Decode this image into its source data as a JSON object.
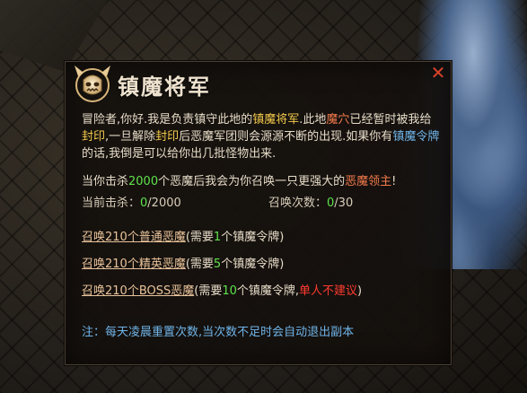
{
  "dialog": {
    "title": "镇魔将军",
    "intro": {
      "p1": "冒险者,你好.我是负责镇守此地的",
      "name": "镇魔将军",
      "p2": ".此地",
      "cave": "魔穴",
      "p3": "已经暂时被我给",
      "seal1": "封印",
      "p4": ",一旦解除",
      "seal2": "封印",
      "p5": "后恶魔军团则会源源不断的出现.如果你有",
      "token": "镇魔令牌",
      "p6": "的话,我倒是可以给你出几批怪物出来."
    },
    "summon_info": {
      "p1": "当你击杀",
      "count": "2000",
      "p2": "个恶魔后我会为你召唤一只更强大的",
      "lord": "恶魔领主",
      "p3": "!"
    },
    "kills": {
      "label": "当前击杀：",
      "current": "0",
      "total": "/2000"
    },
    "summons": {
      "label": "召唤次数：",
      "current": "0",
      "total": "/30"
    },
    "options": [
      {
        "link": "召唤210个普通恶魔",
        "pre": "(需要",
        "qty": "1",
        "post": "个镇魔令牌)"
      },
      {
        "link": "召唤210个精英恶魔",
        "pre": "(需要",
        "qty": "5",
        "post": "个镇魔令牌)"
      },
      {
        "link": "召唤210个BOSS恶魔",
        "pre": "(需要",
        "qty": "10",
        "post": "个镇魔令牌,",
        "warn": "单人不建议",
        "end": ")"
      }
    ],
    "note": "注：每天凌晨重置次数,当次数不足时会自动退出副本"
  },
  "colors": {
    "highlight": "#f2c94c",
    "number": "#5ee34a",
    "warning": "#ff3b2f",
    "note": "#6fb4e8"
  },
  "icons": {
    "emblem": "demon-skull-emblem-icon",
    "close": "close-icon"
  }
}
